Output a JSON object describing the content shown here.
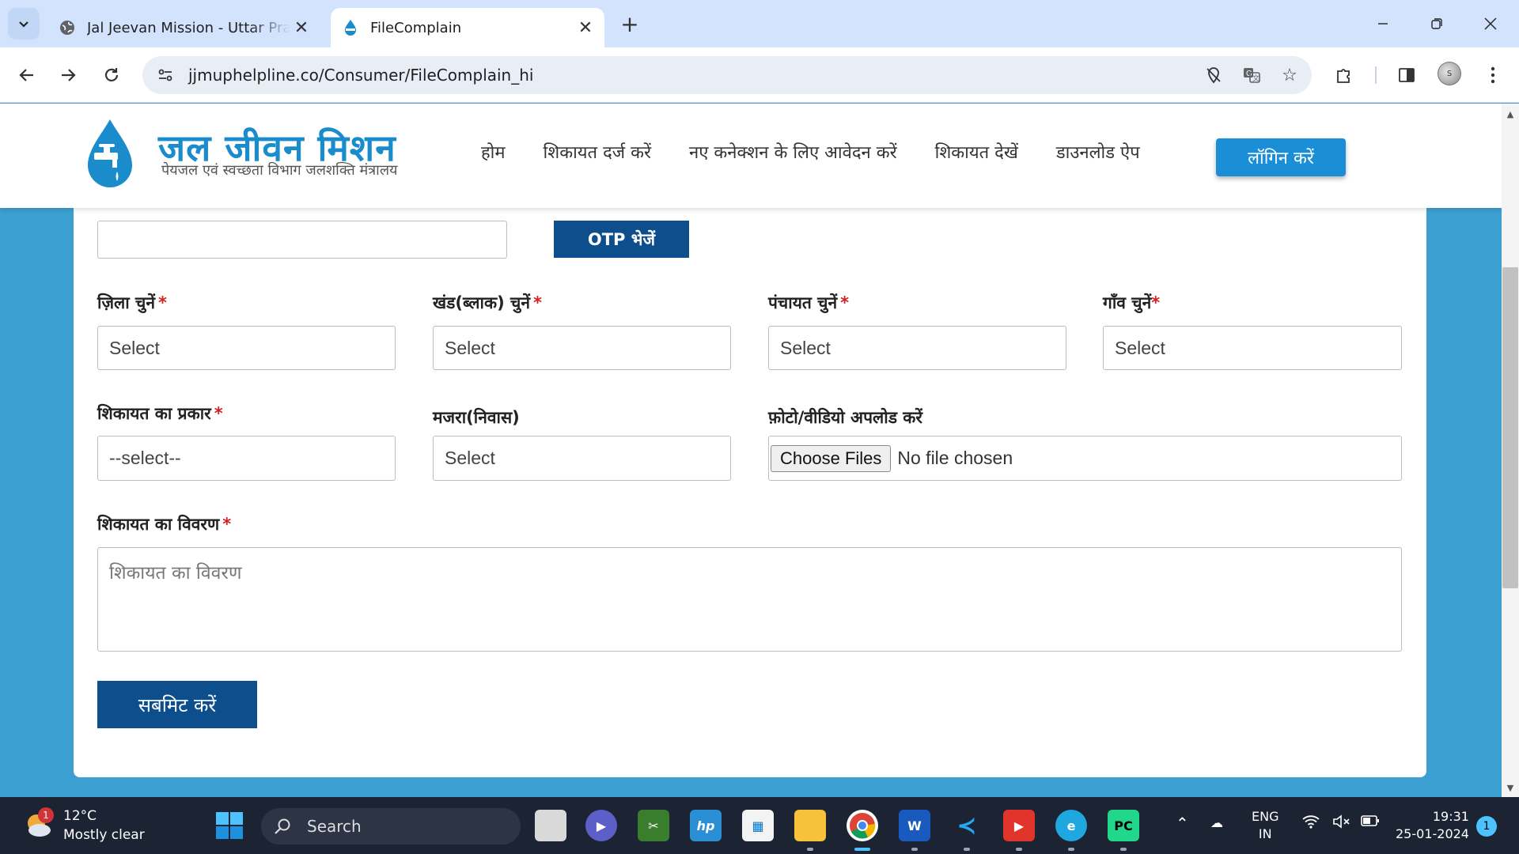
{
  "browser": {
    "tabs": [
      {
        "title": "Jal Jeevan Mission - Uttar Pradesh",
        "active": false
      },
      {
        "title": "FileComplain",
        "active": true
      }
    ],
    "url": "jjmuphelpline.co/Consumer/FileComplain_hi",
    "profile_initial": "S"
  },
  "site": {
    "logo_title": "जल जीवन मिशन",
    "logo_subtitle": "पेयजल एवं स्वच्छता विभाग जलशक्ति मंत्रालय",
    "nav": [
      "होम",
      "शिकायत दर्ज करें",
      "नए कनेक्शन के लिए आवेदन करें",
      "शिकायत देखें",
      "डाउनलोड ऐप"
    ],
    "login_label": "लॉगिन करें",
    "brand_color": "#1a8ccc"
  },
  "form": {
    "mobile_value": "",
    "otp_button": "OTP भेजें",
    "district": {
      "label": "ज़िला चुनें",
      "value": "Select"
    },
    "block": {
      "label": "खंड(ब्लाक) चुनें",
      "value": "Select"
    },
    "panchayat": {
      "label": "पंचायत चुनें",
      "value": "Select"
    },
    "village": {
      "label": "गाँव चुनें",
      "value": "Select"
    },
    "complaint_type": {
      "label": "शिकायत का प्रकार",
      "value": "--select--"
    },
    "majra": {
      "label": "मजरा(निवास)",
      "value": "Select"
    },
    "upload": {
      "label": "फ़ोटो/वीडियो अपलोड करें",
      "button": "Choose Files",
      "status": "No file chosen"
    },
    "description": {
      "label": "शिकायत का विवरण",
      "placeholder": "शिकायत का विवरण"
    },
    "required_mark": "*",
    "submit_label": "सबमिट करें"
  },
  "taskbar": {
    "weather_temp": "12°C",
    "weather_desc": "Mostly clear",
    "weather_badge": "1",
    "search_label": "Search",
    "lang_top": "ENG",
    "lang_bottom": "IN",
    "time": "19:31",
    "date": "25-01-2024",
    "notification_count": "1"
  }
}
